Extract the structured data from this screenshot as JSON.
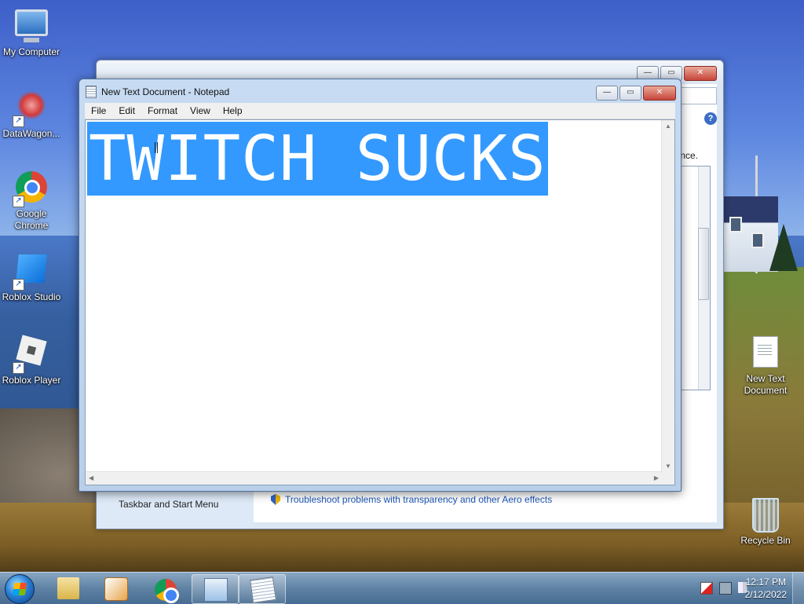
{
  "desktop": {
    "icons": [
      {
        "label": "My Computer"
      },
      {
        "label": "DataWagon..."
      },
      {
        "label": "Google Chrome"
      },
      {
        "label": "Roblox Studio"
      },
      {
        "label": "Roblox Player"
      },
      {
        "label": "New Text Document"
      },
      {
        "label": "Recycle Bin"
      }
    ]
  },
  "background_window": {
    "fragment_text": "nce.",
    "sidebar_link": "Taskbar and Start Menu",
    "troubleshoot_link": "Troubleshoot problems with transparency and other Aero effects",
    "help_glyph": "?"
  },
  "notepad": {
    "title": "New Text Document - Notepad",
    "menu": [
      "File",
      "Edit",
      "Format",
      "View",
      "Help"
    ],
    "content": "TWITCH SUCKS",
    "content_selected": true,
    "selection_color": "#3399ff"
  },
  "taskbar": {
    "pinned": [
      {
        "name": "Windows Explorer",
        "icon": "folder-icon"
      },
      {
        "name": "Windows Media Player",
        "icon": "media-player-icon"
      },
      {
        "name": "Google Chrome",
        "icon": "chrome-icon"
      },
      {
        "name": "Control Panel",
        "icon": "control-panel-icon",
        "open": true
      },
      {
        "name": "Notepad",
        "icon": "notepad-icon",
        "open": true
      }
    ],
    "clock_time": "12:17 PM",
    "clock_date": "2/12/2022"
  }
}
